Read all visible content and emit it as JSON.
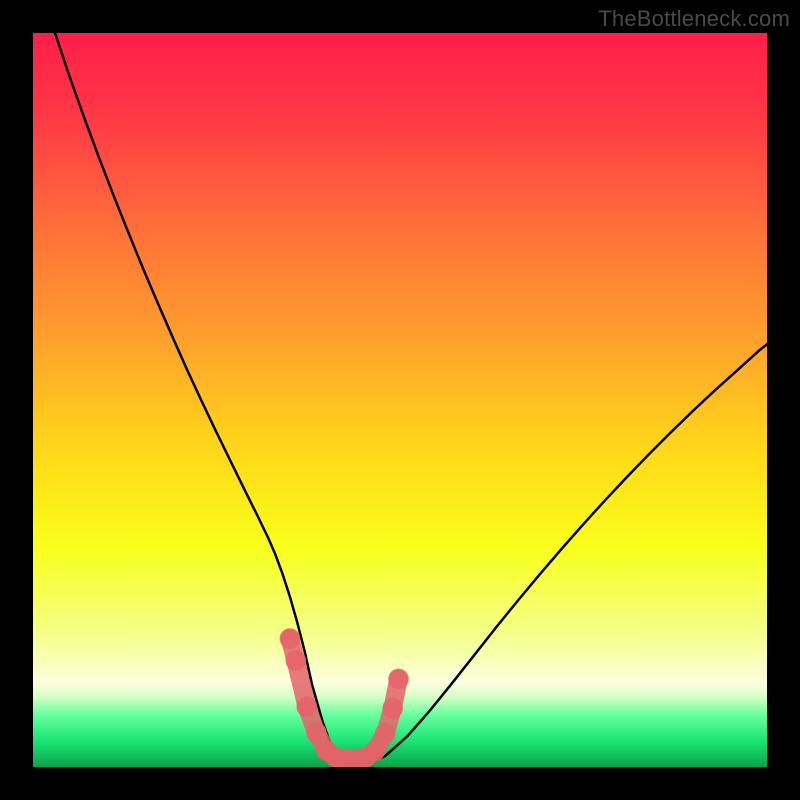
{
  "watermark": "TheBottleneck.com",
  "chart_data": {
    "type": "line",
    "title": "",
    "xlabel": "",
    "ylabel": "",
    "xlim": [
      0,
      100
    ],
    "ylim": [
      0,
      100
    ],
    "background_gradient": {
      "stops": [
        {
          "offset": 0.0,
          "color": "#ff1e4a"
        },
        {
          "offset": 0.12,
          "color": "#ff3a46"
        },
        {
          "offset": 0.25,
          "color": "#ff6a3a"
        },
        {
          "offset": 0.4,
          "color": "#ff9a2e"
        },
        {
          "offset": 0.55,
          "color": "#ffd21a"
        },
        {
          "offset": 0.7,
          "color": "#f9ff1a"
        },
        {
          "offset": 0.82,
          "color": "#f4ff8a"
        },
        {
          "offset": 0.885,
          "color": "#fbffdf"
        },
        {
          "offset": 0.905,
          "color": "#d3ffc4"
        },
        {
          "offset": 0.93,
          "color": "#63ff9d"
        },
        {
          "offset": 0.965,
          "color": "#19e573"
        },
        {
          "offset": 1.0,
          "color": "#0aa34a"
        }
      ]
    },
    "series": [
      {
        "name": "bottleneck-curve",
        "stroke": "#000000",
        "stroke_width": 2.5,
        "x": [
          3,
          5,
          7,
          9,
          11,
          13,
          15,
          17,
          19,
          21,
          23,
          25,
          27,
          29,
          30.5,
          32,
          33,
          34,
          35,
          36,
          37,
          38,
          39.5,
          41,
          43,
          45,
          48,
          51,
          54,
          57,
          60,
          63,
          66,
          69,
          72,
          75,
          78,
          81,
          84,
          87,
          90,
          93,
          96,
          99,
          100
        ],
        "y": [
          100,
          94,
          88.4,
          83,
          77.8,
          72.8,
          67.9,
          63.2,
          58.6,
          54.1,
          49.8,
          45.6,
          41.5,
          37.4,
          34.4,
          31.3,
          29.0,
          26.3,
          23.2,
          19.7,
          15.8,
          11.3,
          6.0,
          2.0,
          0.3,
          0.3,
          1.5,
          4.2,
          7.6,
          11.3,
          15.1,
          18.9,
          22.6,
          26.2,
          29.7,
          33.1,
          36.4,
          39.6,
          42.7,
          45.7,
          48.6,
          51.4,
          54.1,
          56.8,
          57.6
        ]
      }
    ],
    "valley_markers": {
      "stroke": "#e4636a",
      "fill": "#e4636a",
      "opacity": 0.85,
      "points": [
        {
          "x": 35.0,
          "y": 17.5
        },
        {
          "x": 35.8,
          "y": 14.5
        },
        {
          "x": 37.3,
          "y": 8.2
        },
        {
          "x": 38.6,
          "y": 4.7
        },
        {
          "x": 40.0,
          "y": 2.2
        },
        {
          "x": 41.3,
          "y": 1.3
        },
        {
          "x": 42.6,
          "y": 1.1
        },
        {
          "x": 44.0,
          "y": 1.1
        },
        {
          "x": 45.3,
          "y": 1.3
        },
        {
          "x": 46.6,
          "y": 2.2
        },
        {
          "x": 48.0,
          "y": 4.6
        },
        {
          "x": 49.0,
          "y": 8.0
        },
        {
          "x": 49.8,
          "y": 12.0
        }
      ],
      "radius_data_units": 1.4
    }
  }
}
